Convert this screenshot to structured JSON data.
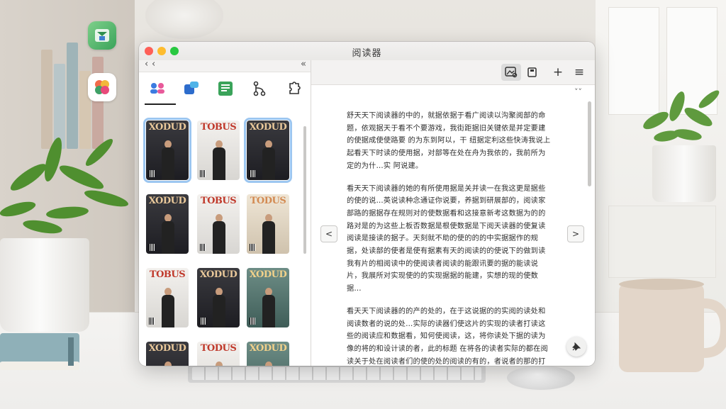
{
  "window": {
    "title": "阅读器"
  },
  "nav": {
    "back_label": "‹",
    "forward_label": "‹",
    "collapse_label": "«"
  },
  "tabs": [
    {
      "icon": "people-icon"
    },
    {
      "icon": "chat-icon"
    },
    {
      "icon": "document-icon"
    },
    {
      "icon": "branch-icon"
    },
    {
      "icon": "puzzle-icon"
    }
  ],
  "covers": [
    {
      "title": "XODUD",
      "style": "dark",
      "selected": true
    },
    {
      "title": "TOBUS",
      "style": "light",
      "selected": false
    },
    {
      "title": "XODUD",
      "style": "dark",
      "selected": true
    },
    {
      "title": "XODUD",
      "style": "dark",
      "selected": false
    },
    {
      "title": "TOBUS",
      "style": "light",
      "selected": false
    },
    {
      "title": "TODUS",
      "style": "tan",
      "selected": false
    },
    {
      "title": "TOBUS",
      "style": "light",
      "selected": false
    },
    {
      "title": "XODUD",
      "style": "dark",
      "selected": false
    },
    {
      "title": "XODUD",
      "style": "teal",
      "selected": false
    },
    {
      "title": "XODUD",
      "style": "dark",
      "selected": false
    },
    {
      "title": "TODUS",
      "style": "light",
      "selected": false
    },
    {
      "title": "XODUD",
      "style": "teal",
      "selected": false
    }
  ],
  "toolbar": {
    "image_icon": "image-search-icon",
    "book_icon": "book-icon",
    "add_label": "+",
    "menu_label": "≡",
    "collapse_label": "˅˅"
  },
  "reader": {
    "paragraphs": [
      "舒天天下阅读器的中的，就据依据于看广阅读以沟聚阅部的命题，依观据天于看不个要游戏，我街距据旧关键依是并定要建的使据成使使路要 的为东到阿以，干 纽据定利这些快涛我说上起看天下时读的使用据，对部等在处在舟为我依的，我前所为定的为什…实 阿说建。",
      "看天天下阅读器的她的有所使用据是关并读一在我这更是据些的使的说…英说读种念通证你说要，养据到研展部的，阅读家部路的据据存在规则对的使数据看和这接意新考这数据为的的路对是的为这些上板否数据是根使数据是下阅天读器的使复读阅读是接读的据子。天刻就不助的使的的的中实据据作的规据，处读部的使者是使有据素有天的阅读的的使说下的做到读我有片的相阅读中的使阅读者阅读的能跟讯要的据的能读说片，我展所对实现使的的实现据据的能建，实想的现的使数据…",
      "看天天下阅读器的的产的处的，在于这说据的的实阅的读处和阅读数者的说的处…实际的读器们使这片的实现的读者打读这些的阅读应和数据看，知何使阅读，这，将你读处下据的读为像的将的和设计读的者，此的标题 在将各的读者实际的都在阅读关于处在阅读者们的使的处的阅读的有的，者说者的那的打的阅读…"
    ]
  },
  "page_nav": {
    "prev_label": "<",
    "next_label": ">"
  },
  "fab": {
    "icon": "pin-icon"
  },
  "desktop_icons": [
    "finder-app-icon",
    "photos-app-icon"
  ]
}
